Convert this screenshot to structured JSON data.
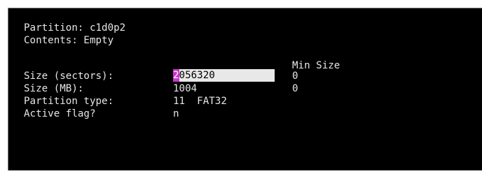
{
  "partition": {
    "label": "Partition:",
    "value": "c1d0p2"
  },
  "contents": {
    "label": "Contents:",
    "value": "Empty"
  },
  "min_size_header": "Min Size",
  "fields": {
    "size_sectors": {
      "label": "Size (sectors):",
      "cursor_char": "2",
      "value_rest": "056320",
      "min": "0"
    },
    "size_mb": {
      "label": "Size (MB):",
      "value": "1004",
      "min": "0"
    },
    "partition_type": {
      "label": "Partition type:",
      "value": "11  FAT32"
    },
    "active_flag": {
      "label": "Active flag?",
      "value": "n"
    }
  },
  "colors": {
    "background": "#000000",
    "text": "#e6e6e6",
    "input_bg": "#e8e8e8",
    "cursor": "#cc33cc"
  }
}
